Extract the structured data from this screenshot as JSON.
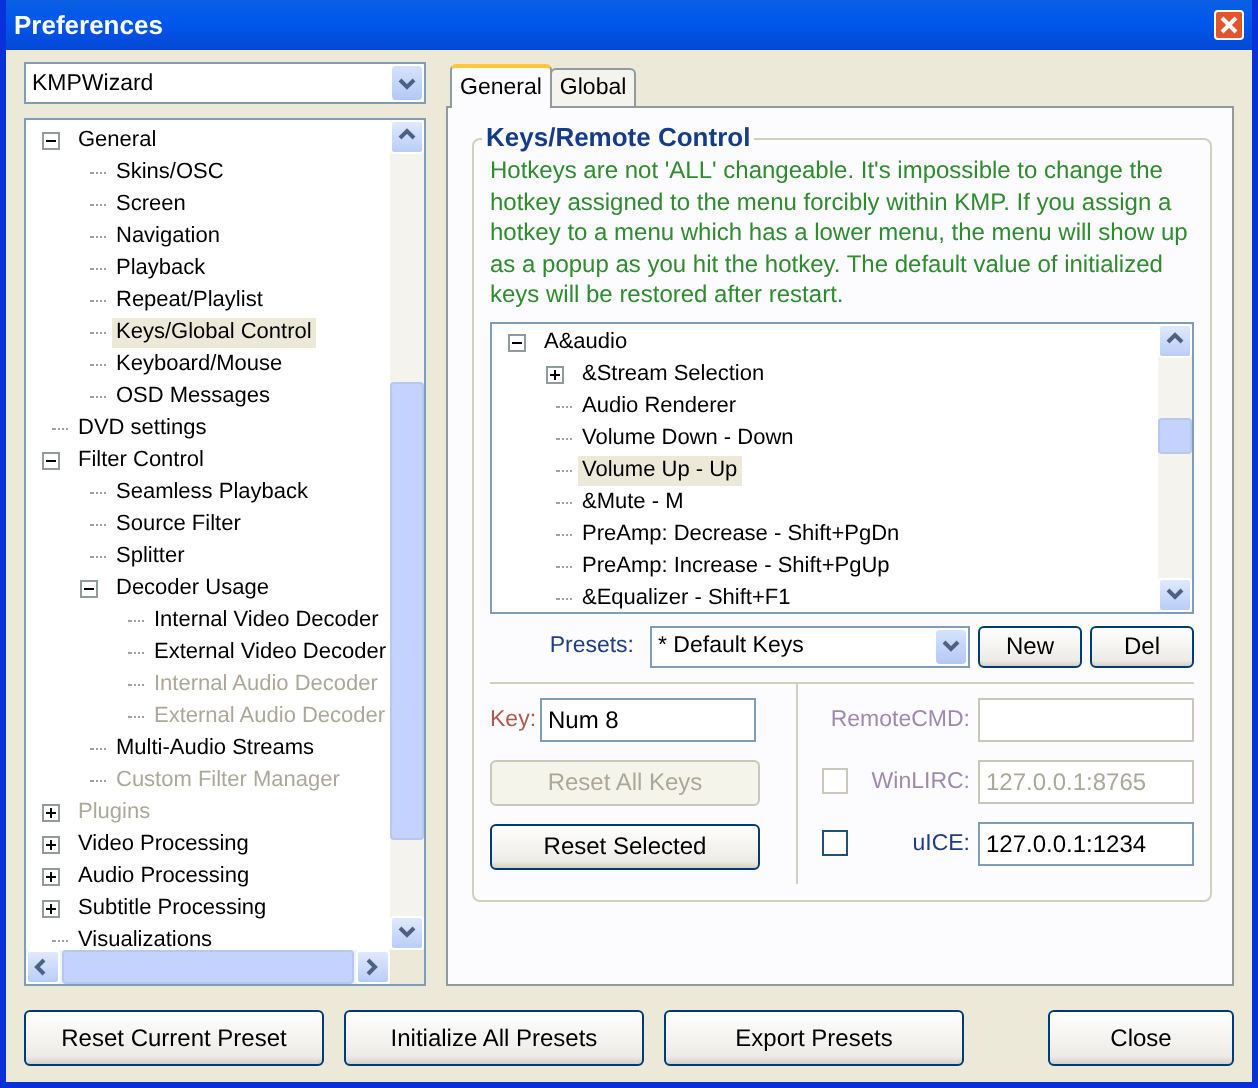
{
  "window": {
    "title": "Preferences"
  },
  "sidebar": {
    "profile": "KMPWizard",
    "tree": [
      {
        "label": "General",
        "expanded": true,
        "selected": false,
        "disabled": false,
        "children": [
          {
            "label": "Skins/OSC",
            "selected": false,
            "disabled": false
          },
          {
            "label": "Screen",
            "selected": false,
            "disabled": false
          },
          {
            "label": "Navigation",
            "selected": false,
            "disabled": false
          },
          {
            "label": "Playback",
            "selected": false,
            "disabled": false
          },
          {
            "label": "Repeat/Playlist",
            "selected": false,
            "disabled": false
          },
          {
            "label": "Keys/Global Control",
            "selected": true,
            "disabled": false
          },
          {
            "label": "Keyboard/Mouse",
            "selected": false,
            "disabled": false
          },
          {
            "label": "OSD Messages",
            "selected": false,
            "disabled": false
          }
        ]
      },
      {
        "label": "DVD settings",
        "selected": false,
        "disabled": false
      },
      {
        "label": "Filter Control",
        "expanded": true,
        "selected": false,
        "disabled": false,
        "children": [
          {
            "label": "Seamless Playback",
            "selected": false,
            "disabled": false
          },
          {
            "label": "Source Filter",
            "selected": false,
            "disabled": false
          },
          {
            "label": "Splitter",
            "selected": false,
            "disabled": false
          },
          {
            "label": "Decoder Usage",
            "expanded": true,
            "selected": false,
            "disabled": false,
            "children": [
              {
                "label": "Internal Video Decoder",
                "selected": false,
                "disabled": false
              },
              {
                "label": "External Video Decoder",
                "selected": false,
                "disabled": false
              },
              {
                "label": "Internal Audio Decoder",
                "selected": false,
                "disabled": true
              },
              {
                "label": "External Audio Decoder",
                "selected": false,
                "disabled": true
              }
            ]
          },
          {
            "label": "Multi-Audio Streams",
            "selected": false,
            "disabled": false
          },
          {
            "label": "Custom Filter Manager",
            "selected": false,
            "disabled": true
          }
        ]
      },
      {
        "label": "Plugins",
        "expanded": false,
        "selected": false,
        "disabled": true
      },
      {
        "label": "Video Processing",
        "expanded": false,
        "selected": false,
        "disabled": false
      },
      {
        "label": "Audio Processing",
        "expanded": false,
        "selected": false,
        "disabled": false
      },
      {
        "label": "Subtitle Processing",
        "expanded": false,
        "selected": false,
        "disabled": false
      },
      {
        "label": "Visualizations",
        "selected": false,
        "disabled": false
      }
    ]
  },
  "tabs": [
    {
      "label": "General",
      "selected": true
    },
    {
      "label": "Global",
      "selected": false
    }
  ],
  "group": {
    "title": "Keys/Remote Control",
    "note": "Hotkeys are not 'ALL' changeable. It's impossible to change the hotkey assigned to the menu forcibly within KMP. If you assign a hotkey to a menu which has a lower menu, the menu will show up as a popup as you hit the hotkey. The default value of initialized keys will be restored after restart.",
    "hotkeys": [
      {
        "label": "A&audio",
        "expanded": true,
        "selected": false,
        "disabled": false,
        "children": [
          {
            "label": "&Stream Selection",
            "expanded": false,
            "selected": false,
            "disabled": false
          },
          {
            "label": "Audio Renderer",
            "selected": false,
            "disabled": false
          },
          {
            "label": "Volume Down - Down",
            "selected": false,
            "disabled": false
          },
          {
            "label": "Volume Up - Up",
            "selected": true,
            "disabled": false
          },
          {
            "label": "&Mute - M",
            "selected": false,
            "disabled": false
          },
          {
            "label": "PreAmp: Decrease - Shift+PgDn",
            "selected": false,
            "disabled": false
          },
          {
            "label": "PreAmp: Increase - Shift+PgUp",
            "selected": false,
            "disabled": false
          },
          {
            "label": "&Equalizer - Shift+F1",
            "selected": false,
            "disabled": false
          }
        ]
      }
    ],
    "presets": {
      "label": "Presets:",
      "value": "* Default Keys",
      "buttons": [
        "New",
        "Del"
      ]
    },
    "key": {
      "label": "Key:",
      "value": "Num 8"
    },
    "key_buttons": [
      {
        "label": "Reset All Keys",
        "disabled": true
      },
      {
        "label": "Reset Selected",
        "disabled": false
      }
    ],
    "remote": [
      {
        "kind": "field",
        "label": "RemoteCMD:",
        "disabled": true
      },
      {
        "kind": "check",
        "label": "WinLIRC:",
        "value": "127.0.0.1:8765",
        "checked": false,
        "disabled": true
      },
      {
        "kind": "check",
        "label": "uICE:",
        "value": "127.0.0.1:1234",
        "checked": false,
        "disabled": false
      }
    ]
  },
  "buttons": [
    "Reset Current Preset",
    "Initialize All Presets",
    "Export Presets",
    "Close"
  ]
}
